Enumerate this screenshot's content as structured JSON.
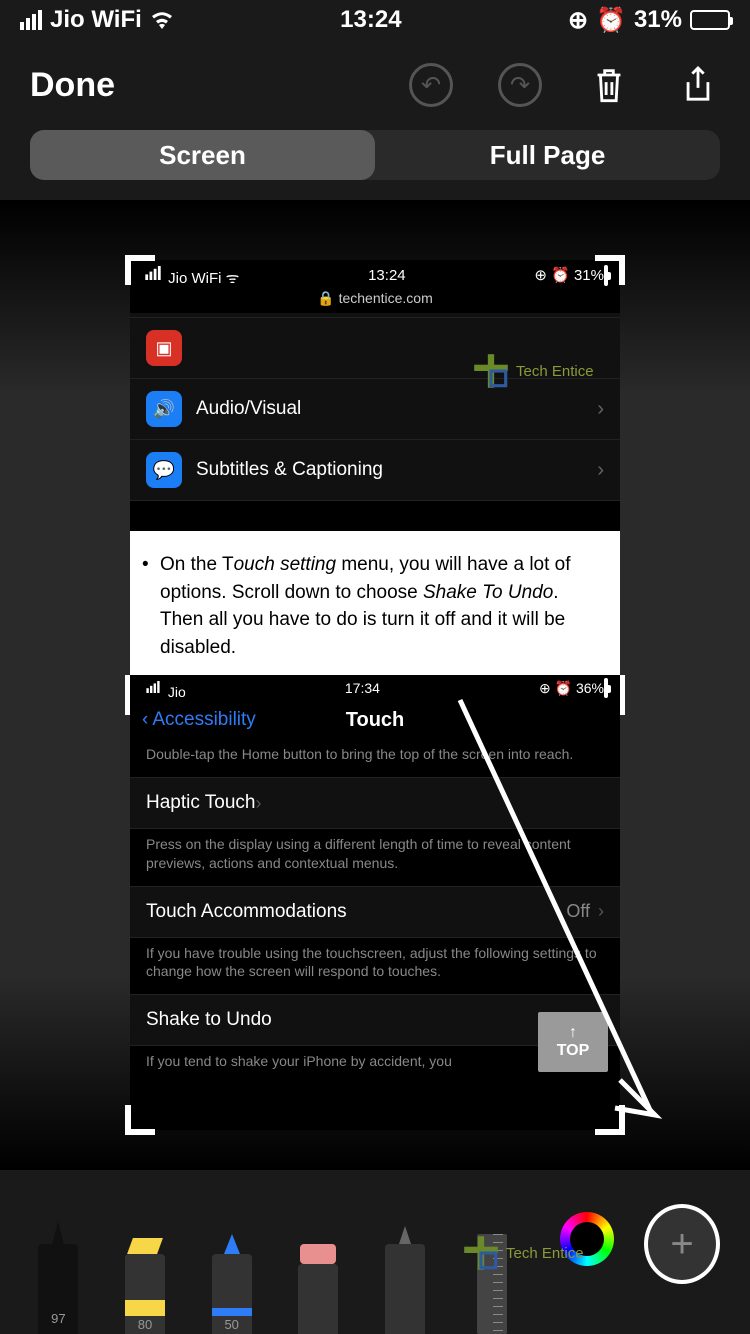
{
  "status": {
    "carrier": "Jio WiFi",
    "time": "13:24",
    "battery_pct": "31%"
  },
  "toolbar": {
    "done": "Done"
  },
  "segment": {
    "screen": "Screen",
    "full_page": "Full Page"
  },
  "inner": {
    "status": {
      "carrier": "Jio WiFi",
      "time": "13:24",
      "battery_pct": "31%"
    },
    "url": "techentice.com",
    "rows": [
      {
        "label": "Audio/Visual"
      },
      {
        "label": "Subtitles & Captioning"
      }
    ],
    "article_prefix": "On the T",
    "article_italic1": "ouch setting",
    "article_mid": " menu, you will have a lot of options. Scroll down to choose ",
    "article_italic2": "Shake To Undo",
    "article_suffix": ". Then all you have to do is turn it off and it will be disabled.",
    "sub": {
      "status": {
        "carrier": "Jio",
        "time": "17:34",
        "battery_pct": "36%"
      },
      "back": "Accessibility",
      "title": "Touch",
      "desc1": "Double-tap the Home button to bring the top of the screen into reach.",
      "row1": "Haptic Touch",
      "desc2": "Press on the display using a different length of time to reveal content previews, actions and contextual menus.",
      "row2": "Touch Accommodations",
      "row2_val": "Off",
      "desc3": "If you have trouble using the touchscreen, adjust the following settings to change how the screen will respond to touches.",
      "row3": "Shake to Undo",
      "desc4": "If you tend to shake your iPhone by accident, you",
      "top_btn": "TOP"
    }
  },
  "tools": {
    "pen_size": "97",
    "hl_size": "80",
    "pencil_size": "50"
  },
  "watermark": "Tech Entice"
}
